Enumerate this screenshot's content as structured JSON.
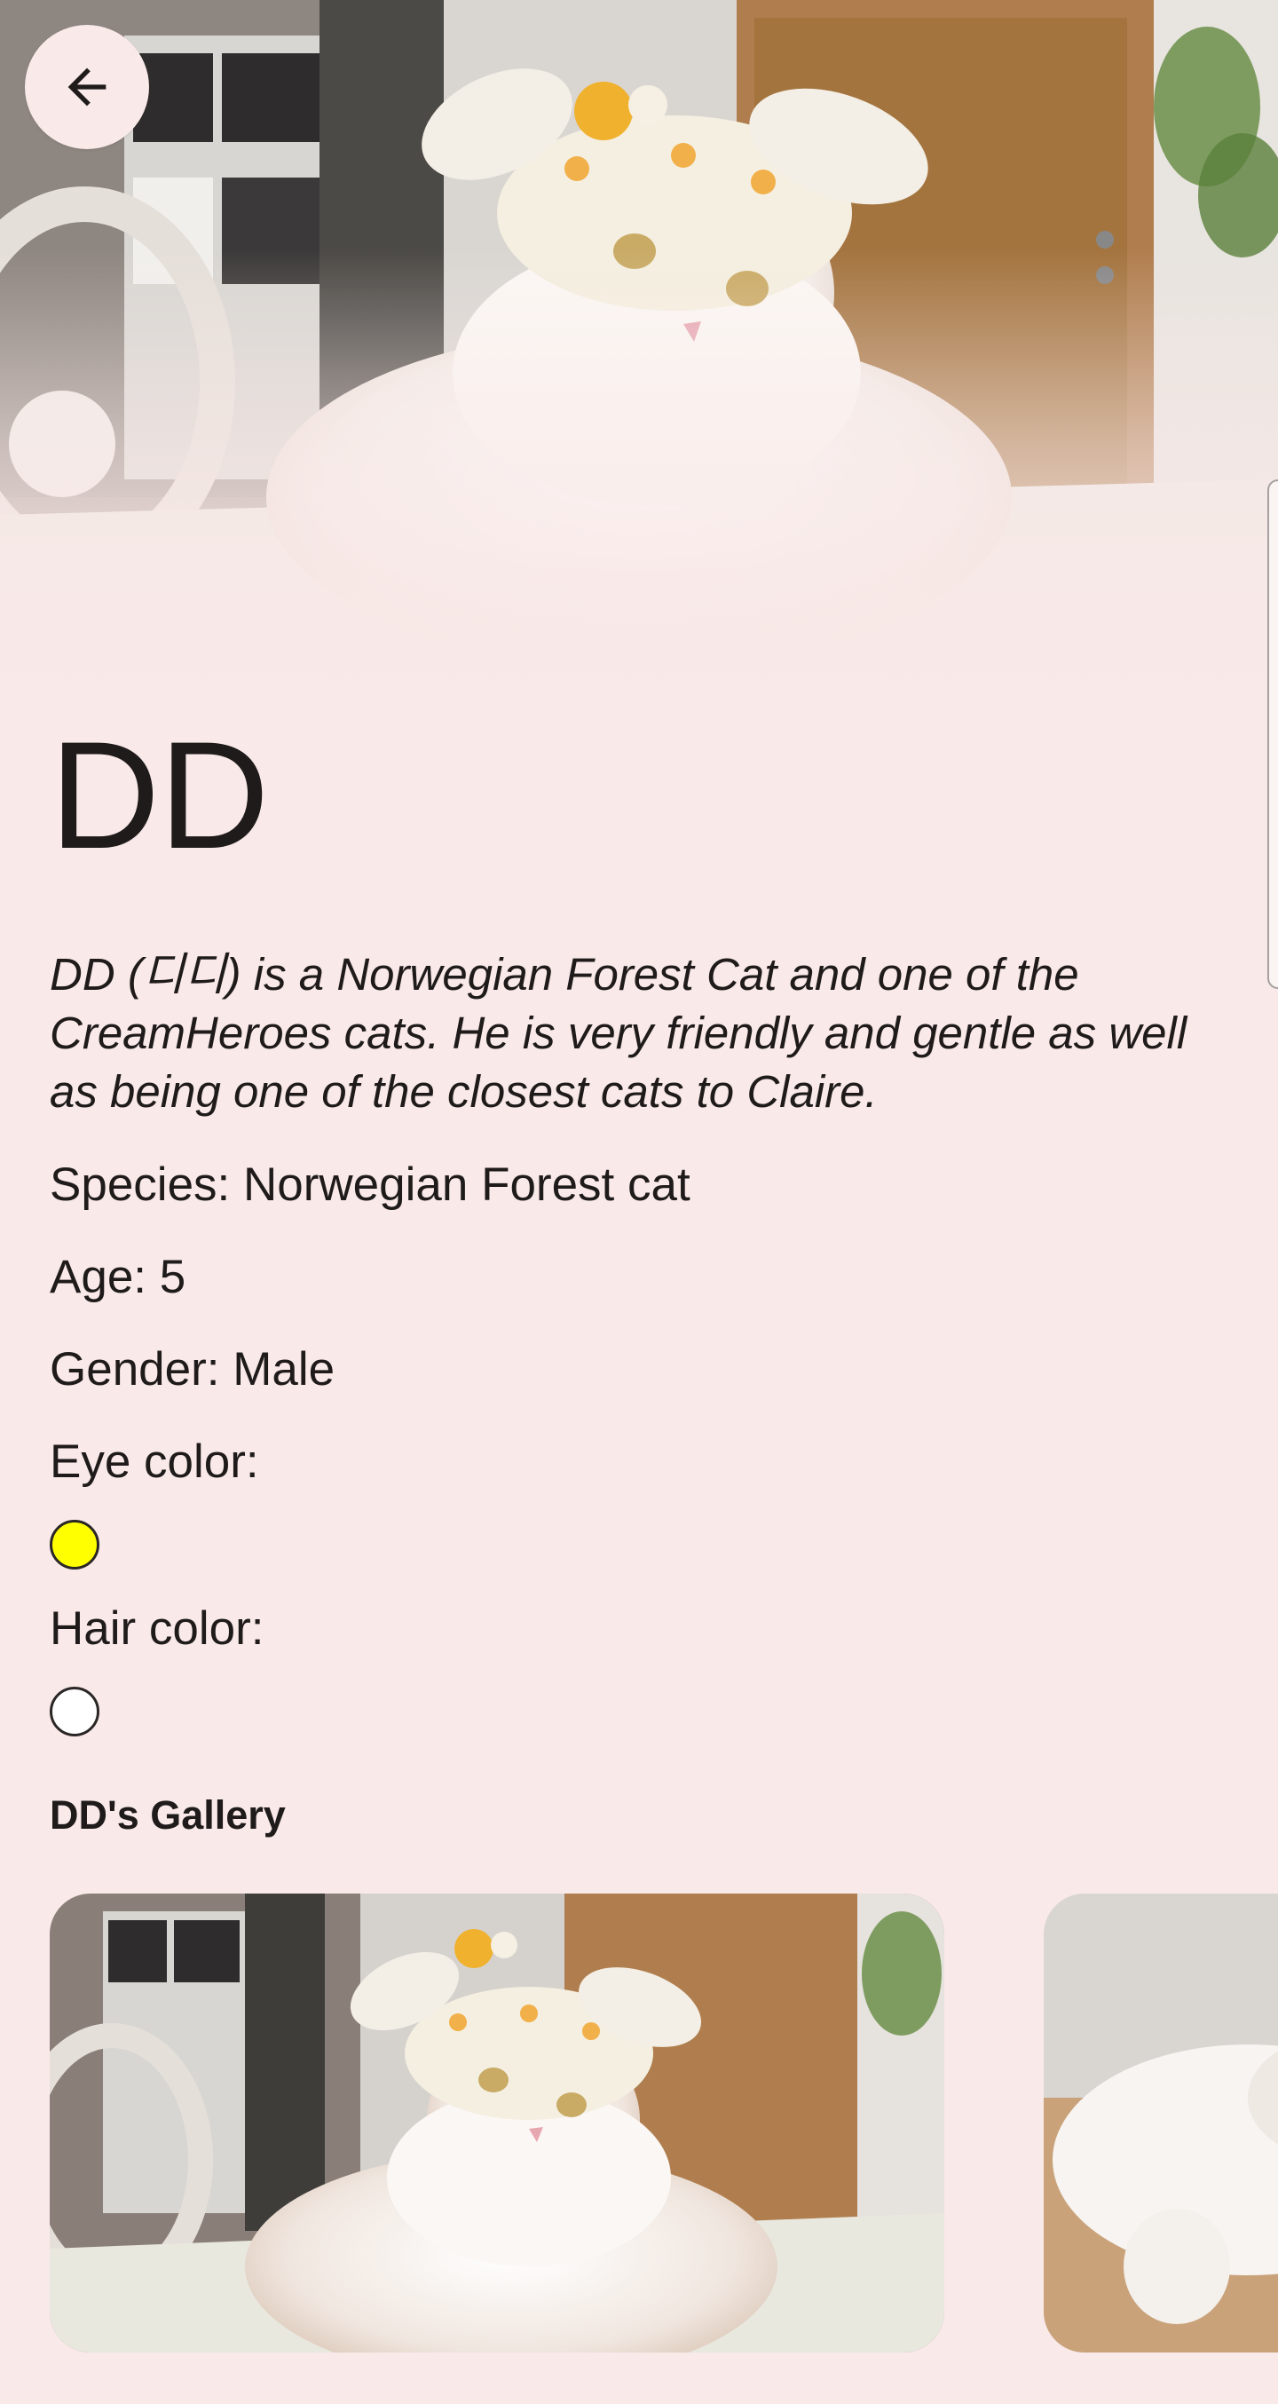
{
  "app": {
    "back_icon": "arrow-back-icon",
    "background_color": "#f9e9e8"
  },
  "cat": {
    "name": "DD",
    "description": "DD (디디) is a Norwegian Forest Cat and one of the CreamHeroes cats. He is very friendly and gentle as well as being one of the closest cats to Claire.",
    "species_line": "Species: Norwegian Forest cat",
    "age_line": "Age: 5",
    "gender_line": "Gender: Male",
    "eye_color_label": "Eye color:",
    "eye_color": "#ffff00",
    "hair_color_label": "Hair color:",
    "hair_color": "#ffffff"
  },
  "gallery": {
    "title": "DD's Gallery",
    "photos": [
      {
        "subject": "cat-with-bunny-ears-hat"
      },
      {
        "subject": "cat-lying-on-wood"
      }
    ]
  }
}
